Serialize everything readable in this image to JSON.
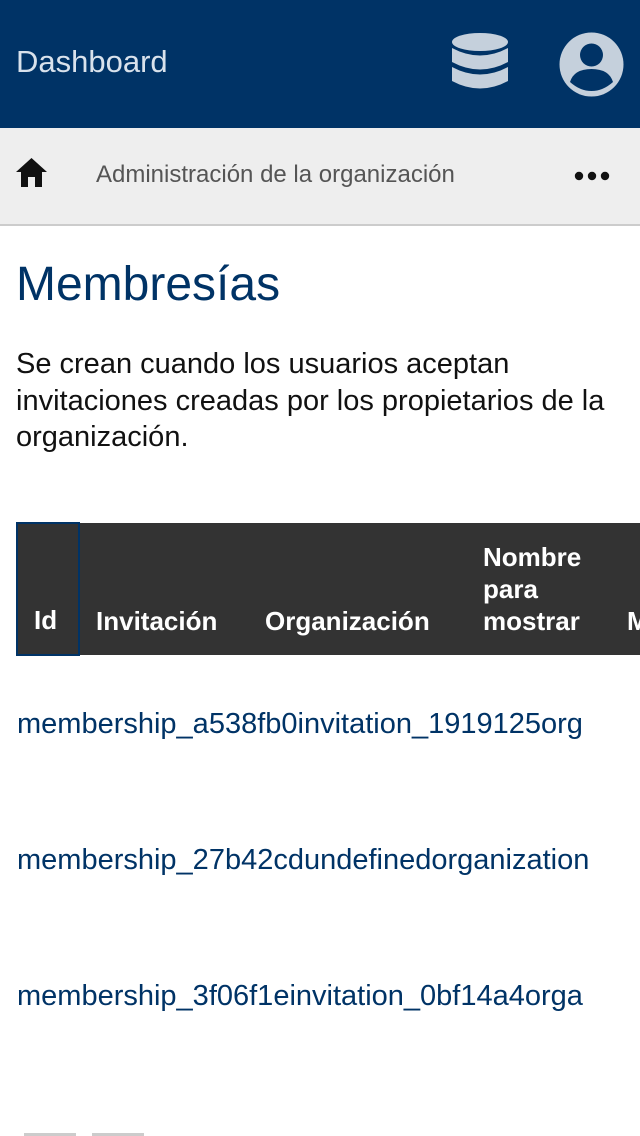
{
  "topbar": {
    "title": "Dashboard",
    "colors": {
      "background": "#003366",
      "icon": "#c5d0dc"
    },
    "icons": [
      "database-icon",
      "account-circle-icon"
    ]
  },
  "breadcrumb": {
    "home_icon": "home-icon",
    "current": "Administración de la organización",
    "more_icon": "more-horizontal-icon"
  },
  "page": {
    "title": "Membresías",
    "description": "Se crean cuando los usuarios aceptan invitaciones creadas por los propietarios de la organización."
  },
  "table": {
    "headers": [
      "Id",
      "Invitación",
      "Organización",
      "Nombre para mostrar",
      "M c e"
    ],
    "rows": [
      {
        "text": "membership_a538fb0invitation_1919125org"
      },
      {
        "text": "membership_27b42cdundefinedorganization"
      },
      {
        "text": "membership_3f06f1einvitation_0bf14a4orga"
      }
    ],
    "colors": {
      "header_bg": "#333333",
      "link": "#003366"
    }
  }
}
